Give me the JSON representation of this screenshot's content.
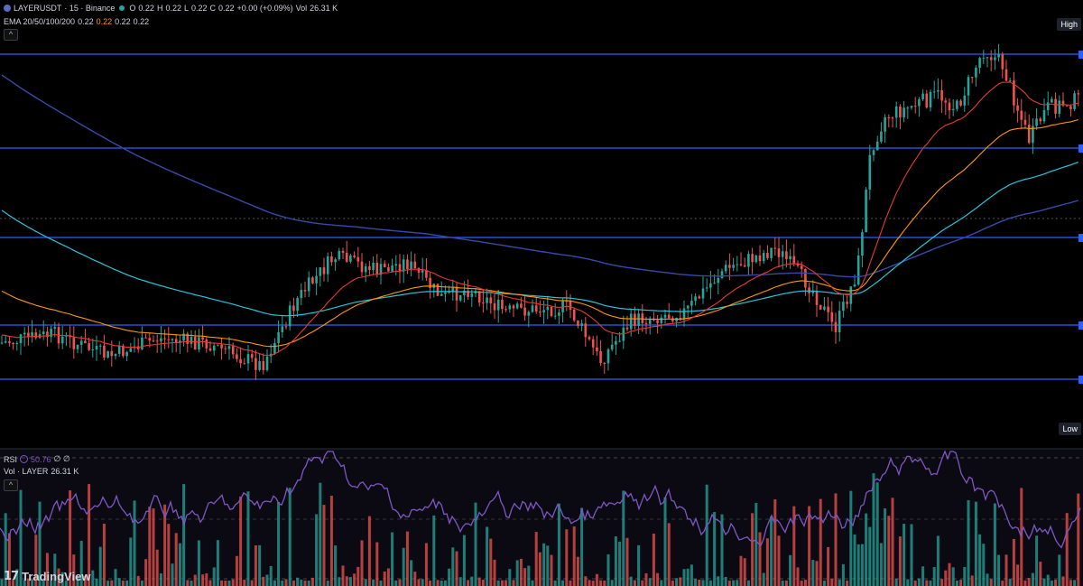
{
  "header": {
    "symbol": "LAYERUSDT",
    "interval_exchange": "· 15 · Binance",
    "ohlc": {
      "o_label": "O",
      "o": "0.22",
      "h_label": "H",
      "h": "0.22",
      "l_label": "L",
      "l": "0.22",
      "c_label": "C",
      "c": "0.22",
      "change": "+0.00 (+0.09%)",
      "vol_label": "Vol",
      "vol": "26.31 K"
    },
    "ema": {
      "label": "EMA 20/50/100/200",
      "v20": "0.22",
      "v50": "0.22",
      "v100": "0.22",
      "v200": "0.22"
    },
    "collapse_icon": "^"
  },
  "axis_tags": {
    "high": "High",
    "low": "Low"
  },
  "rsi_legend": {
    "label": "RSI",
    "value": "50.76",
    "extra": "∅ ∅"
  },
  "vol_legend": {
    "label": "Vol · LAYER",
    "value": "26.31 K"
  },
  "brand": {
    "name": "TradingView",
    "mark": "17"
  },
  "colors": {
    "background": "#000000",
    "up": "#26a69a",
    "down": "#ef5350",
    "ema20": "#e53935",
    "ema50": "#ff9800",
    "ema100": "#26c6da",
    "ema200": "#3949ab",
    "levels": "#2962ff",
    "rsi": "#7e57c2"
  }
}
